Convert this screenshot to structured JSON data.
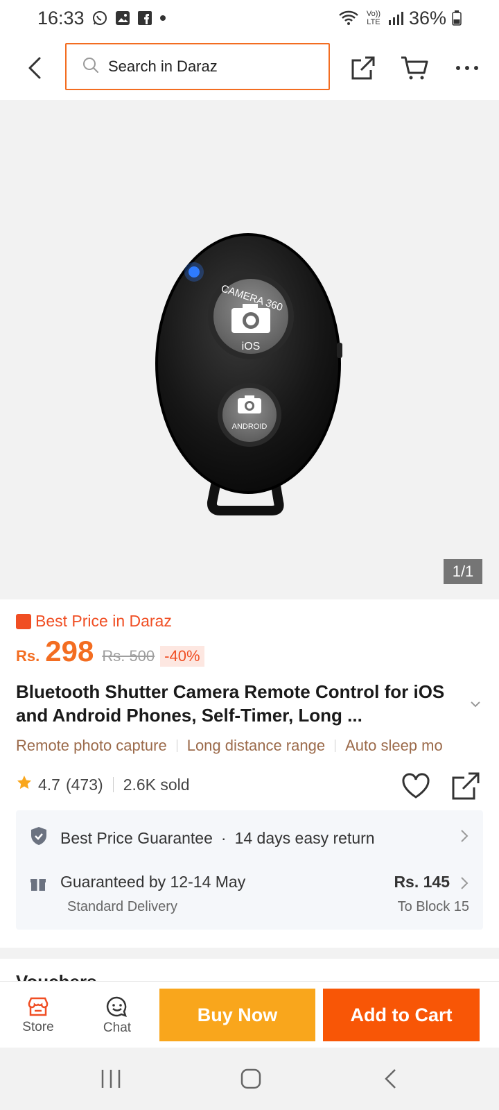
{
  "status_bar": {
    "time": "16:33",
    "battery": "36%",
    "network_label": "Vo)) LTE"
  },
  "top_nav": {
    "search_placeholder": "Search in Daraz",
    "icons": [
      "back-arrow-icon",
      "search-icon",
      "share-icon",
      "cart-icon",
      "more-icon"
    ]
  },
  "gallery": {
    "page_indicator": "1/1",
    "image": {
      "button_top_line1": "CAMERA 360",
      "button_top_label": "iOS",
      "button_bottom_label": "ANDROID"
    }
  },
  "product": {
    "best_price_label": "Best Price in Daraz",
    "currency": "Rs.",
    "price": "298",
    "original_price": "Rs. 500",
    "discount": "-40%",
    "title": "Bluetooth Shutter Camera Remote Control for iOS and Android Phones, Self-Timer, Long ...",
    "features": [
      "Remote photo capture",
      "Long distance range",
      "Auto sleep mo"
    ],
    "rating": "4.7",
    "rating_count": "(473)",
    "sold": "2.6K sold"
  },
  "info_card": {
    "guarantee": "Best Price Guarantee",
    "return_policy": "14 days easy return",
    "delivery_date": "Guaranteed by 12-14 May",
    "delivery_type": "Standard Delivery",
    "delivery_fee": "Rs. 145",
    "delivery_location": "To Block 15"
  },
  "next_section_peek": "Vouchers",
  "bottom_bar": {
    "store_label": "Store",
    "chat_label": "Chat",
    "buy_now_label": "Buy Now",
    "add_to_cart_label": "Add to Cart"
  },
  "colors": {
    "accent_orange": "#f85606",
    "buy_now_yellow": "#f9a61c",
    "price_orange": "#f36d21",
    "feature_brown": "#9b6a4a"
  }
}
